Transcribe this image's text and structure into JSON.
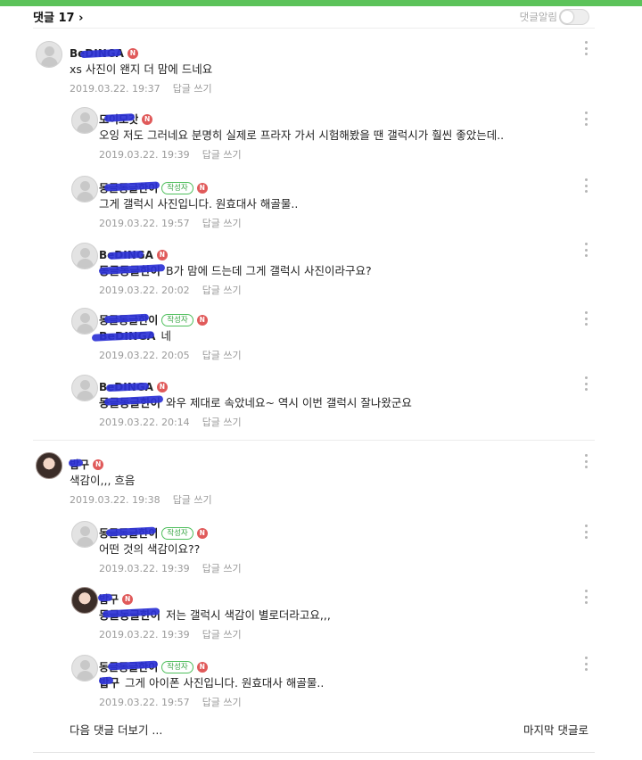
{
  "header": {
    "title": "댓글 17",
    "chevron": "›",
    "alarm_label": "댓글알림",
    "alarm_on": false
  },
  "icons": {
    "n_badge": "N",
    "kebab": "more-vertical-icon",
    "chevron": "chevron-right-icon"
  },
  "author_badge_label": "작성자",
  "reply_label": "답글 쓰기",
  "comments": [
    {
      "nick": "BeDINGA",
      "body": "xs 사진이 왠지 더 맘에 드네요",
      "date": "2019.03.22. 19:37",
      "mention": ""
    },
    {
      "nick": "모이모갓",
      "body": "오잉 저도 그러네요 분명히 실제로 프라자 가서 시험해봤을 땐 갤럭시가 훨씬 좋았는데..",
      "date": "2019.03.22. 19:39",
      "mention": ""
    },
    {
      "nick": "동글동글한이",
      "body": "그게 갤럭시 사진입니다. 원효대사 해골물..",
      "date": "2019.03.22. 19:57",
      "mention": ""
    },
    {
      "nick": "BeDINGA",
      "mention": "동글동글한이",
      "body": "B가 맘에 드는데 그게 갤럭시 사진이라구요?",
      "date": "2019.03.22. 20:02"
    },
    {
      "nick": "동글동글한이",
      "mention": "BeDINGA",
      "body": "네",
      "date": "2019.03.22. 20:05"
    },
    {
      "nick": "BeDINGA",
      "mention": "동글동글한이",
      "body": "와우 제대로 속았네요~ 역시 이번 갤럭시 잘나왔군요",
      "date": "2019.03.22. 20:14"
    },
    {
      "nick": "밥구",
      "body": "색감이,,, 흐음",
      "date": "2019.03.22. 19:38",
      "mention": ""
    },
    {
      "nick": "동글동글한이",
      "body": "어떤 것의 색감이요??",
      "date": "2019.03.22. 19:39",
      "mention": ""
    },
    {
      "nick": "밥구",
      "mention": "동글동글한이",
      "body": "저는 갤럭시 색감이 별로더라고요,,,",
      "date": "2019.03.22. 19:39"
    },
    {
      "nick": "동글동글한이",
      "mention": "밥구",
      "body": "그게 아이폰 사진입니다. 원효대사 해골물..",
      "date": "2019.03.22. 19:57"
    }
  ],
  "footer": {
    "more_label": "다음 댓글 더보기 ...",
    "last_label": "마지막 댓글로"
  },
  "colors": {
    "brand_green": "#5cc35a",
    "badge_red": "#e05a5a",
    "censor_blue": "#2d32d6"
  }
}
